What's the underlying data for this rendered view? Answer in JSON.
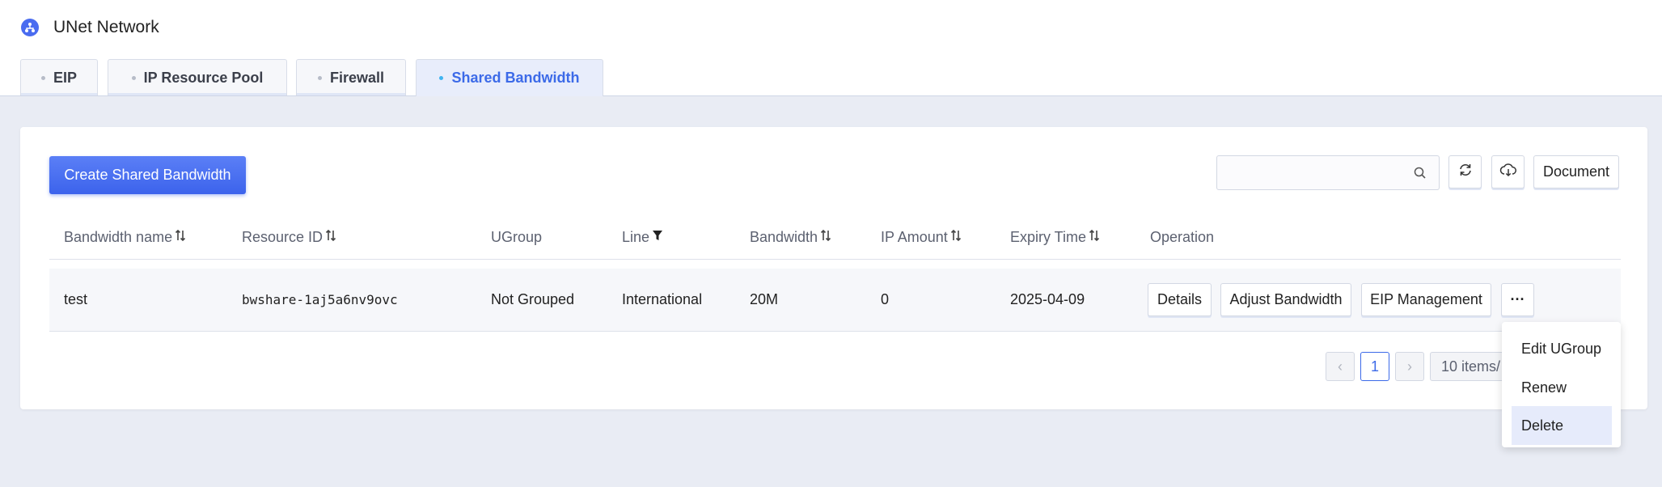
{
  "app": {
    "title": "UNet Network"
  },
  "tabs": [
    {
      "label": "EIP",
      "active": false
    },
    {
      "label": "IP Resource Pool",
      "active": false
    },
    {
      "label": "Firewall",
      "active": false
    },
    {
      "label": "Shared Bandwidth",
      "active": true
    }
  ],
  "toolbar": {
    "create_label": "Create Shared Bandwidth",
    "search_value": "",
    "search_placeholder": "",
    "refresh_icon": "refresh-icon",
    "download_icon": "cloud-download-icon",
    "document_label": "Document"
  },
  "table": {
    "columns": [
      {
        "label": "Bandwidth name",
        "icon": "sort-icon"
      },
      {
        "label": "Resource ID",
        "icon": "sort-icon"
      },
      {
        "label": "UGroup",
        "icon": ""
      },
      {
        "label": "Line",
        "icon": "filter-icon"
      },
      {
        "label": "Bandwidth",
        "icon": "sort-icon"
      },
      {
        "label": "IP Amount",
        "icon": "sort-icon"
      },
      {
        "label": "Expiry Time",
        "icon": "sort-icon"
      },
      {
        "label": "Operation",
        "icon": ""
      }
    ],
    "rows": [
      {
        "name": "test",
        "resource_id": "bwshare-1aj5a6nv9ovc",
        "ugroup": "Not Grouped",
        "line": "International",
        "bandwidth": "20M",
        "ip_amount": "0",
        "expiry": "2025-04-09",
        "operations": [
          "Details",
          "Adjust Bandwidth",
          "EIP Management",
          "···"
        ]
      }
    ]
  },
  "pagination": {
    "prev": "‹",
    "current_page": "1",
    "next": "›",
    "page_size": "10 items/"
  },
  "more_menu": {
    "items": [
      "Edit UGroup",
      "Renew",
      "Delete"
    ],
    "highlighted": "Delete"
  },
  "colors": {
    "accent": "#3c6ae8",
    "background": "#e9ecf4",
    "active_tab_bg": "#e8edfb"
  }
}
